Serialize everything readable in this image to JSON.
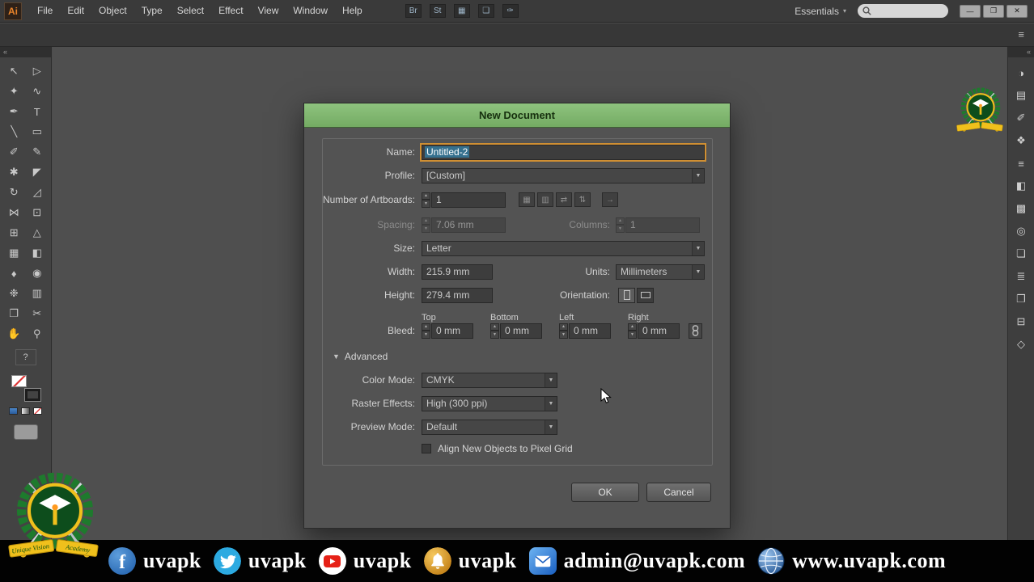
{
  "glyphs": {
    "up": "▲",
    "down": "▼",
    "caret": "▾",
    "tri_down": "▼",
    "arrow_right": "→",
    "collapse_left": "«",
    "collapse_right": "»",
    "question": "?"
  },
  "menubar": {
    "app_badge": "Ai",
    "menus": [
      "File",
      "Edit",
      "Object",
      "Type",
      "Select",
      "Effect",
      "View",
      "Window",
      "Help"
    ],
    "tool_icons": [
      {
        "name": "bridge-icon",
        "glyph": "Br"
      },
      {
        "name": "stock-icon",
        "glyph": "St"
      },
      {
        "name": "arrange-documents-icon",
        "glyph": "▦"
      },
      {
        "name": "document-layout-icon",
        "glyph": "❏"
      },
      {
        "name": "share-icon",
        "glyph": "✑"
      }
    ],
    "workspace_switcher": "Essentials",
    "window_controls": {
      "minimize": "—",
      "restore": "❐",
      "close": "✕"
    }
  },
  "subbar": {
    "panel_toggle_glyph": "≡"
  },
  "left_toolbar": {
    "tools": [
      {
        "name": "selection-tool",
        "glyph": "↖"
      },
      {
        "name": "direct-selection-tool",
        "glyph": "▷"
      },
      {
        "name": "magic-wand-tool",
        "glyph": "✦"
      },
      {
        "name": "lasso-tool",
        "glyph": "∿"
      },
      {
        "name": "pen-tool",
        "glyph": "✒"
      },
      {
        "name": "type-tool",
        "glyph": "T"
      },
      {
        "name": "line-segment-tool",
        "glyph": "╲"
      },
      {
        "name": "rectangle-tool",
        "glyph": "▭"
      },
      {
        "name": "paintbrush-tool",
        "glyph": "✐"
      },
      {
        "name": "pencil-tool",
        "glyph": "✎"
      },
      {
        "name": "blob-brush-tool",
        "glyph": "✱"
      },
      {
        "name": "eraser-tool",
        "glyph": "◤"
      },
      {
        "name": "rotate-tool",
        "glyph": "↻"
      },
      {
        "name": "scale-tool",
        "glyph": "◿"
      },
      {
        "name": "width-tool",
        "glyph": "⋈"
      },
      {
        "name": "free-transform-tool",
        "glyph": "⊡"
      },
      {
        "name": "shape-builder-tool",
        "glyph": "⊞"
      },
      {
        "name": "perspective-grid-tool",
        "glyph": "△"
      },
      {
        "name": "mesh-tool",
        "glyph": "▦"
      },
      {
        "name": "gradient-tool",
        "glyph": "◧"
      },
      {
        "name": "eyedropper-tool",
        "glyph": "♦"
      },
      {
        "name": "blend-tool",
        "glyph": "◉"
      },
      {
        "name": "symbol-sprayer-tool",
        "glyph": "❉"
      },
      {
        "name": "column-graph-tool",
        "glyph": "▥"
      },
      {
        "name": "artboard-tool",
        "glyph": "❐"
      },
      {
        "name": "slice-tool",
        "glyph": "✂"
      },
      {
        "name": "hand-tool",
        "glyph": "✋"
      },
      {
        "name": "zoom-tool",
        "glyph": "⚲"
      }
    ]
  },
  "right_toolbar": {
    "panels": [
      {
        "name": "color-panel-icon",
        "glyph": "◑"
      },
      {
        "name": "swatches-panel-icon",
        "glyph": "▤"
      },
      {
        "name": "brushes-panel-icon",
        "glyph": "✐"
      },
      {
        "name": "symbols-panel-icon",
        "glyph": "❖"
      },
      {
        "name": "stroke-panel-icon",
        "glyph": "≡"
      },
      {
        "name": "gradient-panel-icon",
        "glyph": "◧"
      },
      {
        "name": "transparency-panel-icon",
        "glyph": "▩"
      },
      {
        "name": "appearance-panel-icon",
        "glyph": "◎"
      },
      {
        "name": "graphic-styles-panel-icon",
        "glyph": "❏"
      },
      {
        "name": "layers-panel-icon",
        "glyph": "≣"
      },
      {
        "name": "artboards-panel-icon",
        "glyph": "❐"
      },
      {
        "name": "align-panel-icon",
        "glyph": "⊟"
      },
      {
        "name": "info-panel-icon",
        "glyph": "◇"
      }
    ]
  },
  "dialog": {
    "title": "New Document",
    "name": {
      "label": "Name:",
      "value": "Untitled-2"
    },
    "profile": {
      "label": "Profile:",
      "value": "[Custom]"
    },
    "artboards": {
      "label": "Number of Artboards:",
      "value": "1",
      "layout_buttons": [
        {
          "name": "artboard-grid-by-row-button",
          "glyph": "▦"
        },
        {
          "name": "artboard-grid-by-column-button",
          "glyph": "▥"
        },
        {
          "name": "artboard-arrange-by-row-button",
          "glyph": "⇄"
        },
        {
          "name": "artboard-arrange-by-column-button",
          "glyph": "⇅"
        }
      ],
      "order_glyph": "→"
    },
    "spacing": {
      "label": "Spacing:",
      "value": "7.06 mm"
    },
    "columns": {
      "label": "Columns:",
      "value": "1"
    },
    "size": {
      "label": "Size:",
      "value": "Letter"
    },
    "width": {
      "label": "Width:",
      "value": "215.9 mm"
    },
    "units": {
      "label": "Units:",
      "value": "Millimeters"
    },
    "height": {
      "label": "Height:",
      "value": "279.4 mm"
    },
    "orientation": {
      "label": "Orientation:"
    },
    "bleed": {
      "label": "Bleed:",
      "fields": [
        {
          "header": "Top",
          "value": "0 mm"
        },
        {
          "header": "Bottom",
          "value": "0 mm"
        },
        {
          "header": "Left",
          "value": "0 mm"
        },
        {
          "header": "Right",
          "value": "0 mm"
        }
      ]
    },
    "advanced": {
      "label": "Advanced"
    },
    "color_mode": {
      "label": "Color Mode:",
      "value": "CMYK"
    },
    "raster_effects": {
      "label": "Raster Effects:",
      "value": "High (300 ppi)"
    },
    "preview_mode": {
      "label": "Preview Mode:",
      "value": "Default"
    },
    "pixel_grid_label": "Align New Objects to Pixel Grid",
    "ok": "OK",
    "cancel": "Cancel"
  },
  "footer": {
    "facebook_label": "uvapk",
    "twitter_label": "uvapk",
    "youtube_label": "uvapk",
    "bell_label": "uvapk",
    "email_label": "admin@uvapk.com",
    "website_label": "www.uvapk.com"
  },
  "logo": {
    "ribbon_left": "Unique Vision",
    "ribbon_right": "Academy"
  },
  "colors": {
    "dialog_title_green": "#80b870",
    "selection_blue": "#35708e",
    "focus_orange": "#cf8f33",
    "canvas_gray": "#4f4f4f"
  }
}
